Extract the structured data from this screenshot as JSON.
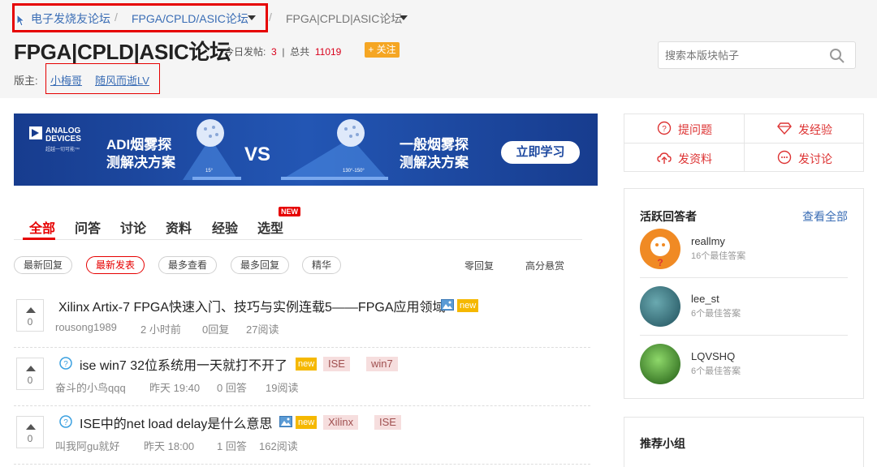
{
  "breadcrumb": {
    "items": [
      "电子发烧友论坛",
      "FPGA/CPLD/ASIC论坛",
      "FPGA|CPLD|ASIC论坛"
    ],
    "separator": "/"
  },
  "forum": {
    "title": "FPGA|CPLD|ASIC论坛",
    "today_label": "今日发帖:",
    "today_count": "3",
    "divider": "|",
    "total_label": "总共",
    "total_count": "11019",
    "follow_label": "+ 关注",
    "moderator_label": "版主:",
    "moderators": [
      "小梅哥",
      "随风而逝LV"
    ]
  },
  "search": {
    "placeholder": "搜索本版块帖子"
  },
  "banner": {
    "logo_name": [
      "ANALOG",
      "DEVICES"
    ],
    "logo_slogan": "超越一切可能™",
    "left_text": [
      "ADI烟雾探",
      "测解决方案"
    ],
    "vs": "VS",
    "right_text": [
      "一般烟雾探",
      "测解决方案"
    ],
    "button": "立即学习",
    "angle_left": "15°",
    "angle_right": "130°-150°"
  },
  "tabs": {
    "items": [
      "全部",
      "问答",
      "讨论",
      "资料",
      "经验",
      "选型"
    ],
    "active_index": 0,
    "new_badge": "NEW"
  },
  "filters": {
    "items": [
      "最新回复",
      "最新发表",
      "最多查看",
      "最多回复",
      "精华"
    ],
    "active_index": 1,
    "plain": [
      "零回复",
      "高分悬赏"
    ]
  },
  "posts": [
    {
      "votes": "0",
      "title": "Xilinx Artix-7 FPGA快速入门、技巧与实例连载5——FPGA应用领域",
      "is_question": false,
      "has_image": true,
      "new_tag": "new",
      "tags": [],
      "author": "rousong1989",
      "time": "2 小时前",
      "replies": "0回复",
      "views": "27阅读"
    },
    {
      "votes": "0",
      "title": "ise win7 32位系统用一天就打不开了",
      "is_question": true,
      "has_image": false,
      "new_tag": "new",
      "tags": [
        "ISE",
        "win7"
      ],
      "author": "奋斗的小鸟qqq",
      "time": "昨天 19:40",
      "replies": "0 回答",
      "views": "19阅读"
    },
    {
      "votes": "0",
      "title": "ISE中的net load delay是什么意思",
      "is_question": true,
      "has_image": true,
      "new_tag": "new",
      "tags": [
        "Xilinx",
        "ISE"
      ],
      "author": "叫我阿gu就好",
      "time": "昨天 18:00",
      "replies": "1 回答",
      "views": "162阅读"
    }
  ],
  "actions": {
    "ask": "提问题",
    "share_exp": "发经验",
    "share_doc": "发资料",
    "discuss": "发讨论"
  },
  "answerers": {
    "title": "活跃回答者",
    "more": "查看全部",
    "users": [
      {
        "name": "reallmy",
        "best": "16个最佳答案",
        "avatar_color": "#f08a24"
      },
      {
        "name": "lee_st",
        "best": "6个最佳答案",
        "avatar_color": "#1f5f6b"
      },
      {
        "name": "LQVSHQ",
        "best": "6个最佳答案",
        "avatar_color": "#3a8a2a"
      }
    ]
  },
  "groups": {
    "title": "推荐小组"
  },
  "colors": {
    "accent": "#e60000",
    "link": "#3a6db5",
    "banner": "#1f4aa0",
    "new_tag": "#f5b800"
  }
}
